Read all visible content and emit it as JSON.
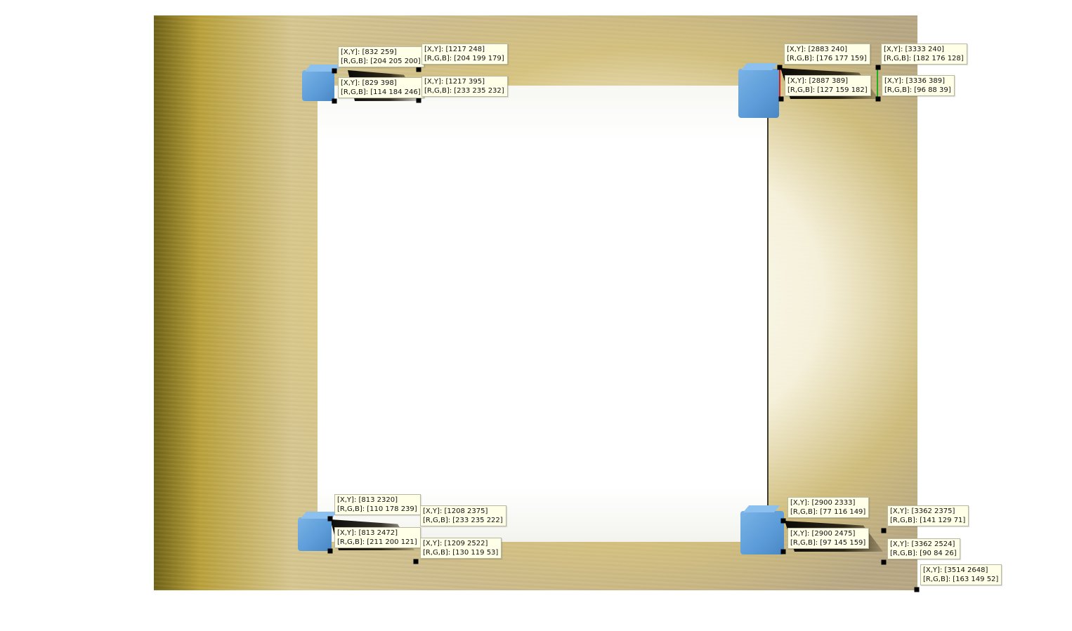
{
  "datatips": [
    {
      "xy": "[X,Y]: [832 259]",
      "rgb": "[R,G,B]: [204 205 200]"
    },
    {
      "xy": "[X,Y]: [1217 248]",
      "rgb": "[R,G,B]: [204 199 179]"
    },
    {
      "xy": "[X,Y]: [829 398]",
      "rgb": "[R,G,B]: [114 184 246]"
    },
    {
      "xy": "[X,Y]: [1217 395]",
      "rgb": "[R,G,B]: [233 235 232]"
    },
    {
      "xy": "[X,Y]: [2883 240]",
      "rgb": "[R,G,B]: [176 177 159]"
    },
    {
      "xy": "[X,Y]: [3333 240]",
      "rgb": "[R,G,B]: [182 176 128]"
    },
    {
      "xy": "[X,Y]: [2887 389]",
      "rgb": "[R,G,B]: [127 159 182]"
    },
    {
      "xy": "[X,Y]: [3336 389]",
      "rgb": "[R,G,B]: [96 88 39]"
    },
    {
      "xy": "[X,Y]: [813 2320]",
      "rgb": "[R,G,B]: [110 178 239]"
    },
    {
      "xy": "[X,Y]: [1208 2375]",
      "rgb": "[R,G,B]: [233 235 222]"
    },
    {
      "xy": "[X,Y]: [813 2472]",
      "rgb": "[R,G,B]: [211 200 121]"
    },
    {
      "xy": "[X,Y]: [1209 2522]",
      "rgb": "[R,G,B]: [130 119 53]"
    },
    {
      "xy": "[X,Y]: [2900 2333]",
      "rgb": "[R,G,B]: [77 116 149]"
    },
    {
      "xy": "[X,Y]: [3362 2375]",
      "rgb": "[R,G,B]: [141 129 71]"
    },
    {
      "xy": "[X,Y]: [2900 2475]",
      "rgb": "[R,G,B]: [97 145 159]"
    },
    {
      "xy": "[X,Y]: [3362 2524]",
      "rgb": "[R,G,B]: [90 84 26]"
    },
    {
      "xy": "[X,Y]: [3514 2648]",
      "rgb": "[R,G,B]: [163 149 52]"
    }
  ],
  "colors": {
    "datatip_bg": "#ffffe8",
    "marker": "#000000",
    "red_line": "#d62020",
    "green_line": "#22b022",
    "cube_blue": "#5b9bd8"
  }
}
